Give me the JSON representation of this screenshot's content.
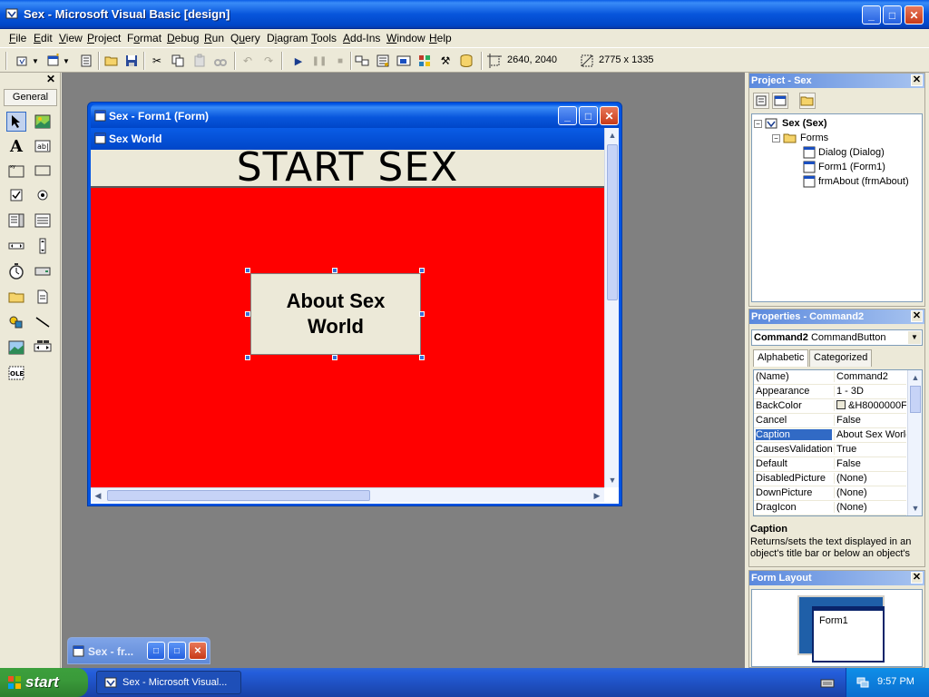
{
  "window": {
    "title": "Sex - Microsoft Visual Basic [design]",
    "minimize": "_",
    "maximize": "□",
    "close": "✕"
  },
  "menu": [
    "File",
    "Edit",
    "View",
    "Project",
    "Format",
    "Debug",
    "Run",
    "Query",
    "Diagram",
    "Tools",
    "Add-Ins",
    "Window",
    "Help"
  ],
  "menu_underline": [
    "F",
    "E",
    "V",
    "P",
    "o",
    "D",
    "R",
    "u",
    "i",
    "T",
    "A",
    "W",
    "H"
  ],
  "toolbar": {
    "position": "2640, 2040",
    "size": "2775 x 1335"
  },
  "toolbox": {
    "close": "✕",
    "tab": "General"
  },
  "form_window": {
    "title": "Sex - Form1 (Form)",
    "form_caption": "Sex World",
    "label_text": "START SEX",
    "button_text": "About Sex World",
    "red_color": "#ff0000"
  },
  "minimized_window": {
    "title": "Sex - fr..."
  },
  "project": {
    "title": "Project - Sex",
    "root": "Sex (Sex)",
    "folder": "Forms",
    "items": [
      "Dialog (Dialog)",
      "Form1 (Form1)",
      "frmAbout (frmAbout)"
    ]
  },
  "properties": {
    "title": "Properties - Command2",
    "object_name": "Command2",
    "object_type": "CommandButton",
    "tabs": [
      "Alphabetic",
      "Categorized"
    ],
    "rows": [
      {
        "name": "(Name)",
        "value": "Command2"
      },
      {
        "name": "Appearance",
        "value": "1 - 3D"
      },
      {
        "name": "BackColor",
        "value": "&H8000000F"
      },
      {
        "name": "Cancel",
        "value": "False"
      },
      {
        "name": "Caption",
        "value": "About Sex World"
      },
      {
        "name": "CausesValidation",
        "value": "True"
      },
      {
        "name": "Default",
        "value": "False"
      },
      {
        "name": "DisabledPicture",
        "value": "(None)"
      },
      {
        "name": "DownPicture",
        "value": "(None)"
      },
      {
        "name": "DragIcon",
        "value": "(None)"
      }
    ],
    "selected_row": 4,
    "desc_title": "Caption",
    "desc_text": "Returns/sets the text displayed in an object's title bar or below an object's"
  },
  "form_layout": {
    "title": "Form Layout",
    "form_label": "Form1"
  },
  "taskbar": {
    "start": "start",
    "item": "Sex - Microsoft Visual...",
    "clock": "9:57 PM"
  }
}
